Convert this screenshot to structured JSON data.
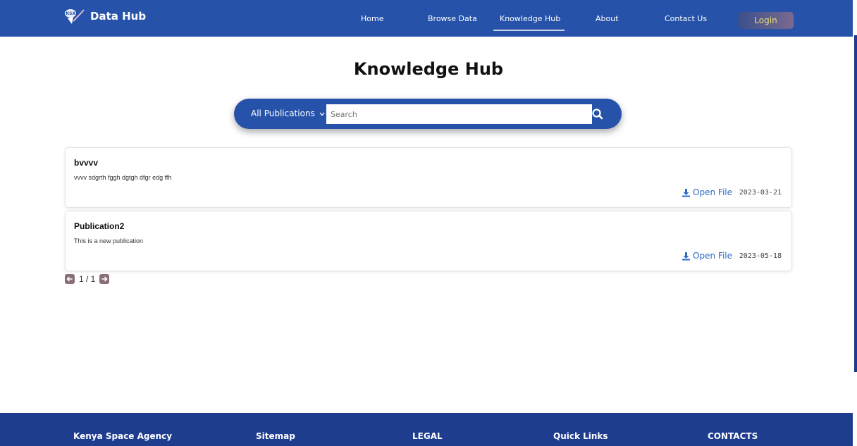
{
  "brand": {
    "name": "Data Hub",
    "logo_icon": "ksa-logo-icon"
  },
  "nav": {
    "items": [
      "Home",
      "Browse Data",
      "Knowledge Hub",
      "About",
      "Contact Us"
    ],
    "active": "Knowledge Hub",
    "login_label": "Login"
  },
  "page": {
    "title": "Knowledge Hub"
  },
  "search": {
    "filter_label": "All Publications",
    "placeholder": "Search",
    "value": "",
    "button_icon": "search-icon"
  },
  "publications": [
    {
      "title": "bvvvv",
      "description": "vvvv sdgrth fggh dgtgh dfgr edg ffh",
      "open_label": "Open File",
      "date": "2023-03-21"
    },
    {
      "title": "Publication2",
      "description": "This is a new publication",
      "open_label": "Open File",
      "date": "2023-05-18"
    }
  ],
  "pagination": {
    "text": "1 / 1"
  },
  "footer": {
    "headings": [
      "Kenya Space Agency",
      "Sitemap",
      "LEGAL",
      "Quick Links",
      "CONTACTS"
    ]
  },
  "colors": {
    "primary": "#2653a9",
    "footer": "#1e3d8f",
    "link": "#2d6bc3",
    "pager": "#8a6f78",
    "login_text": "#e8e07a"
  }
}
